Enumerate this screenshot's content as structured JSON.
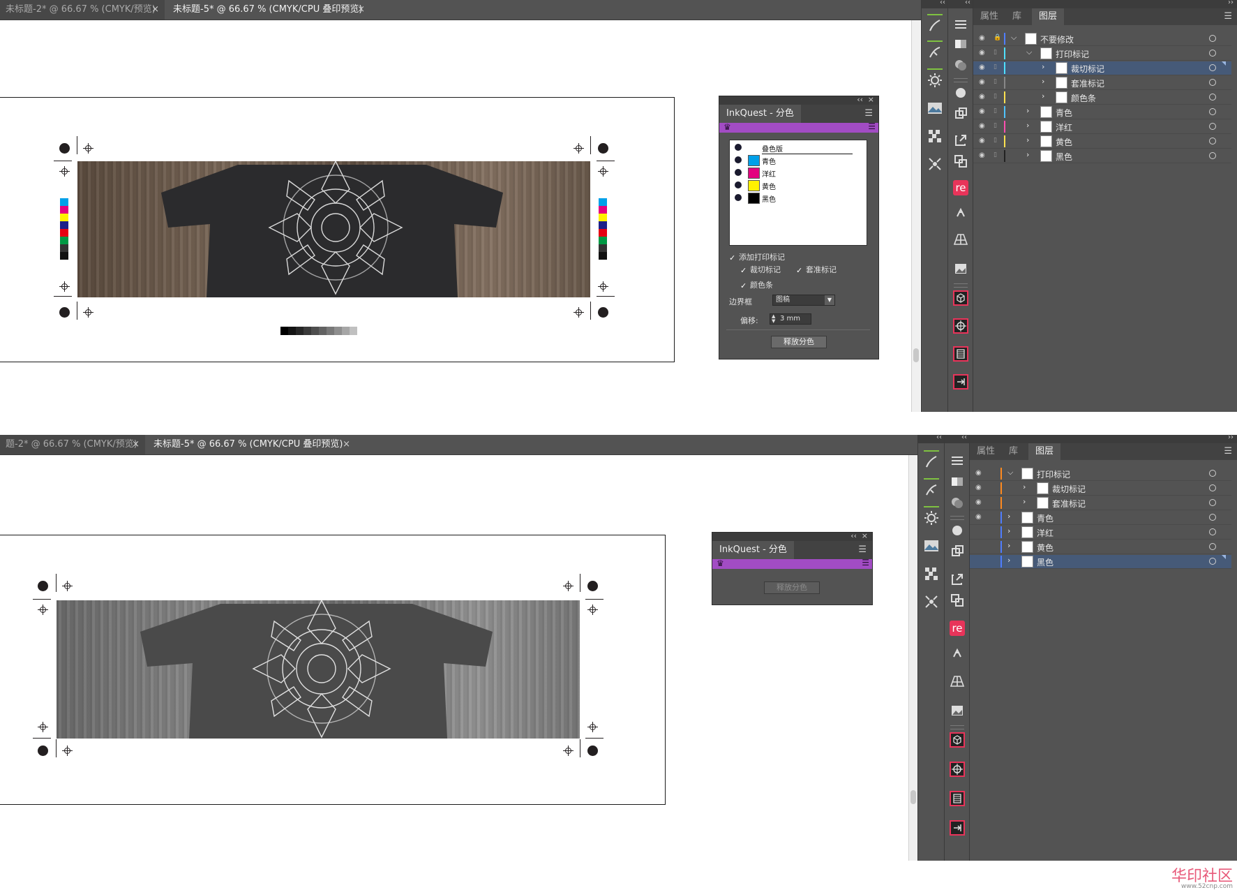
{
  "screen1": {
    "tabs": [
      {
        "label": "未标题-2* @ 66.67 % (CMYK/预览)",
        "close": "×",
        "active": false
      },
      {
        "label": "未标题-5* @ 66.67 % (CMYK/CPU 叠印预览)",
        "close": "×",
        "active": true
      }
    ],
    "panel": {
      "title": "InkQuest - 分色",
      "collapse": "‹‹",
      "close": "×",
      "separations": [
        {
          "label": "叠色版",
          "color": "#ffffff"
        },
        {
          "label": "青色",
          "color": "#00a0e9"
        },
        {
          "label": "洋红",
          "color": "#e4007f"
        },
        {
          "label": "黄色",
          "color": "#fff100"
        },
        {
          "label": "黑色",
          "color": "#000000"
        }
      ],
      "add_marks_label": "添加打印标记",
      "crop_marks_label": "裁切标记",
      "reg_marks_label": "套准标记",
      "color_bar_label": "颜色条",
      "border_label": "边界框",
      "border_value": "图稿",
      "offset_label": "偏移:",
      "offset_value": "3 mm",
      "release_button": "释放分色"
    },
    "layers_panel": {
      "tabs": [
        "属性",
        "库",
        "图层"
      ],
      "active_tab": "图层",
      "rows": [
        {
          "name": "不要修改",
          "indent": 0,
          "expanded": true,
          "color": "#4f7dff",
          "visible": true,
          "locked": true
        },
        {
          "name": "打印标记",
          "indent": 1,
          "expanded": true,
          "color": "#4fe0ff",
          "visible": true,
          "locked": false
        },
        {
          "name": "裁切标记",
          "indent": 2,
          "expanded": false,
          "color": "#4fe0ff",
          "visible": true,
          "locked": false,
          "selected": true
        },
        {
          "name": "套准标记",
          "indent": 2,
          "expanded": false,
          "color": "#888888",
          "visible": true,
          "locked": false
        },
        {
          "name": "颜色条",
          "indent": 2,
          "expanded": false,
          "color": "#ffe14f",
          "visible": true,
          "locked": false
        },
        {
          "name": "青色",
          "indent": 1,
          "expanded": false,
          "color": "#4fc3ff",
          "visible": true,
          "locked": false
        },
        {
          "name": "洋红",
          "indent": 1,
          "expanded": false,
          "color": "#ff4fb0",
          "visible": true,
          "locked": false
        },
        {
          "name": "黄色",
          "indent": 1,
          "expanded": false,
          "color": "#ffe14f",
          "visible": true,
          "locked": false
        },
        {
          "name": "黑色",
          "indent": 1,
          "expanded": false,
          "color": "#222222",
          "visible": true,
          "locked": false
        }
      ]
    }
  },
  "screen2": {
    "tabs": [
      {
        "label": "题-2* @ 66.67 % (CMYK/预览)",
        "close": "×",
        "active": false
      },
      {
        "label": "未标题-5* @ 66.67 % (CMYK/CPU 叠印预览)",
        "close": "×",
        "active": true
      }
    ],
    "panel": {
      "title": "InkQuest - 分色",
      "collapse": "‹‹",
      "close": "×",
      "release_button": "释放分色"
    },
    "layers_panel": {
      "tabs": [
        "属性",
        "库",
        "图层"
      ],
      "active_tab": "图层",
      "rows": [
        {
          "name": "打印标记",
          "indent": 0,
          "expanded": true,
          "color": "#ff8a1f",
          "visible": true
        },
        {
          "name": "裁切标记",
          "indent": 1,
          "expanded": false,
          "color": "#ff8a1f",
          "visible": true
        },
        {
          "name": "套准标记",
          "indent": 1,
          "expanded": false,
          "color": "#ff8a1f",
          "visible": true
        },
        {
          "name": "青色",
          "indent": 0,
          "expanded": false,
          "color": "#4f7dff",
          "visible": true
        },
        {
          "name": "洋红",
          "indent": 0,
          "expanded": false,
          "color": "#4f7dff",
          "visible": false
        },
        {
          "name": "黄色",
          "indent": 0,
          "expanded": false,
          "color": "#4f7dff",
          "visible": false
        },
        {
          "name": "黑色",
          "indent": 0,
          "expanded": false,
          "color": "#4f7dff",
          "visible": false,
          "selected": true
        }
      ]
    }
  },
  "watermark": {
    "text": "华印社区",
    "url": "www.52cnp.com"
  }
}
